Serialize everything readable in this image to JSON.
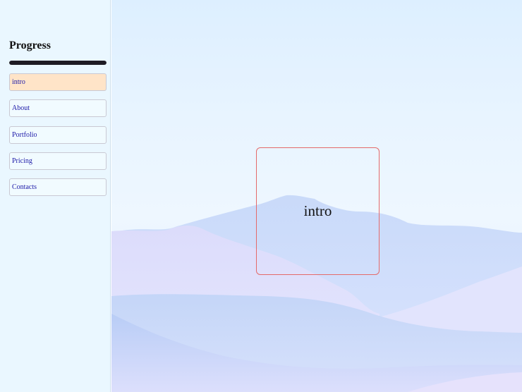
{
  "sidebar": {
    "title": "Progress",
    "progress_percent": 100,
    "items": [
      {
        "label": "intro",
        "active": true
      },
      {
        "label": "About",
        "active": false
      },
      {
        "label": "Portfolio",
        "active": false
      },
      {
        "label": "Pricing",
        "active": false
      },
      {
        "label": "Contacts",
        "active": false
      }
    ]
  },
  "main": {
    "section_label": "intro"
  },
  "colors": {
    "sidebar_bg": "#eaf7ff",
    "active_item_bg": "#ffe4c8",
    "link_text": "#1d1aa8",
    "frame_border": "#e46a6a",
    "progress_bar": "#1e1b24"
  }
}
